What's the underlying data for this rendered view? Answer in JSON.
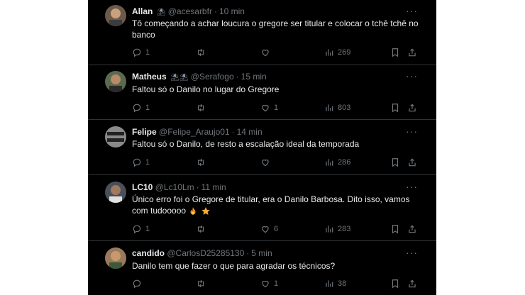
{
  "tweets": [
    {
      "name": "Allan",
      "badge": "⛱",
      "handle": "@acesarbfr",
      "time": "10 min",
      "text": "Tô começando a achar loucura o gregore ser titular e colocar o tchê tchê no banco",
      "replies": "1",
      "retweets": "",
      "likes": "",
      "views": "269",
      "avatar_color": "#6b5a4a"
    },
    {
      "name": "Matheus",
      "badge": "⛱⛱",
      "handle": "@Serafogo",
      "time": "15 min",
      "text": "Faltou só o Danilo no lugar do Gregore",
      "replies": "1",
      "retweets": "",
      "likes": "1",
      "views": "803",
      "avatar_color": "#5a6a4e"
    },
    {
      "name": "Felipe",
      "badge": "",
      "handle": "@Felipe_Araujo01",
      "time": "14 min",
      "text": "Faltou só o Danilo, de resto a escalação ideal da temporada",
      "replies": "1",
      "retweets": "",
      "likes": "",
      "views": "286",
      "avatar_color": "#8a8a8a"
    },
    {
      "name": "LC10",
      "badge": "",
      "handle": "@Lc10Lm",
      "time": "11 min",
      "text": "Único erro foi o Gregore de titular, era o Danilo Barbosa. Dito isso, vamos com tudooooo",
      "replies": "1",
      "retweets": "",
      "likes": "6",
      "views": "283",
      "avatar_color": "#4a4f5a"
    },
    {
      "name": "candido",
      "badge": "",
      "handle": "@CarlosD25285130",
      "time": "5 min",
      "text": "Danilo tem que fazer o que para agradar os técnicos?",
      "replies": "",
      "retweets": "",
      "likes": "1",
      "views": "38",
      "avatar_color": "#9a7a5a"
    }
  ],
  "more_glyph": "···",
  "dot_glyph": "·",
  "colors": {
    "background": "#000000",
    "text": "#e7e9ea",
    "muted": "#71767b",
    "divider": "#2f3336",
    "page": "#ffffff"
  },
  "icons": [
    "reply-icon",
    "retweet-icon",
    "like-icon",
    "views-icon",
    "bookmark-icon",
    "share-icon",
    "fire-emoji",
    "star-emoji"
  ]
}
